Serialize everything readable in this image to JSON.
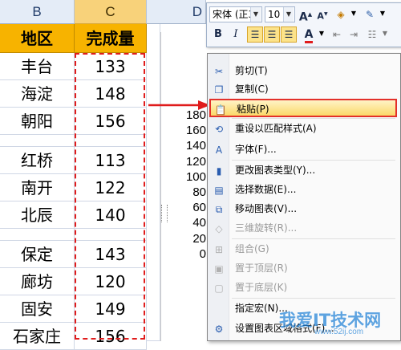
{
  "sheet": {
    "columns": [
      "B",
      "C",
      "D"
    ],
    "header": {
      "region": "地区",
      "value": "完成量"
    },
    "rows": [
      {
        "region": "丰台",
        "value": "133"
      },
      {
        "region": "海淀",
        "value": "148"
      },
      {
        "region": "朝阳",
        "value": "156"
      },
      {
        "region": "",
        "value": ""
      },
      {
        "region": "红桥",
        "value": "113"
      },
      {
        "region": "南开",
        "value": "122"
      },
      {
        "region": "北辰",
        "value": "140"
      },
      {
        "region": "",
        "value": ""
      },
      {
        "region": "保定",
        "value": "143"
      },
      {
        "region": "廊坊",
        "value": "120"
      },
      {
        "region": "固安",
        "value": "149"
      },
      {
        "region": "石家庄",
        "value": "156"
      }
    ]
  },
  "chart": {
    "y_ticks": [
      "180",
      "160",
      "140",
      "120",
      "100",
      "80",
      "60",
      "40",
      "20",
      "0"
    ]
  },
  "toolbar": {
    "font_name": "宋体 (正3",
    "font_size": "10",
    "grow_font": "A",
    "shrink_font": "A",
    "bold": "B",
    "italic": "I",
    "font_color": "A"
  },
  "menu": {
    "items": [
      {
        "label": "剪切(T)",
        "icon": "scissors-icon",
        "glyph": "✂",
        "disabled": false
      },
      {
        "label": "复制(C)",
        "icon": "copy-icon",
        "glyph": "❐",
        "disabled": false
      },
      {
        "label": "粘贴(P)",
        "icon": "paste-icon",
        "glyph": "📋",
        "disabled": false,
        "highlighted": true
      },
      {
        "label": "重设以匹配样式(A)",
        "icon": "reset-style-icon",
        "glyph": "⟲",
        "disabled": false
      },
      {
        "label": "字体(F)...",
        "icon": "font-icon",
        "glyph": "A",
        "disabled": false
      },
      {
        "label": "更改图表类型(Y)...",
        "icon": "chart-type-icon",
        "glyph": "▮",
        "disabled": false
      },
      {
        "label": "选择数据(E)...",
        "icon": "select-data-icon",
        "glyph": "▤",
        "disabled": false
      },
      {
        "label": "移动图表(V)...",
        "icon": "move-chart-icon",
        "glyph": "⧉",
        "disabled": false
      },
      {
        "label": "三维旋转(R)...",
        "icon": "rotate-3d-icon",
        "glyph": "◇",
        "disabled": true
      },
      {
        "label": "组合(G)",
        "icon": "group-icon",
        "glyph": "⊞",
        "disabled": true
      },
      {
        "label": "置于顶层(R)",
        "icon": "bring-front-icon",
        "glyph": "▣",
        "disabled": true
      },
      {
        "label": "置于底层(K)",
        "icon": "send-back-icon",
        "glyph": "▢",
        "disabled": true
      },
      {
        "label": "指定宏(N)...",
        "icon": "",
        "glyph": "",
        "disabled": false
      },
      {
        "label": "设置图表区域格式(F)...",
        "icon": "format-chart-icon",
        "glyph": "⚙",
        "disabled": false
      }
    ]
  },
  "watermark": {
    "text": "我爱IT技术网",
    "url": "www.52ij.com"
  },
  "colors": {
    "header_fill": "#f7b300",
    "highlight_border": "#e3302a",
    "marquee": "#e01c1c"
  }
}
